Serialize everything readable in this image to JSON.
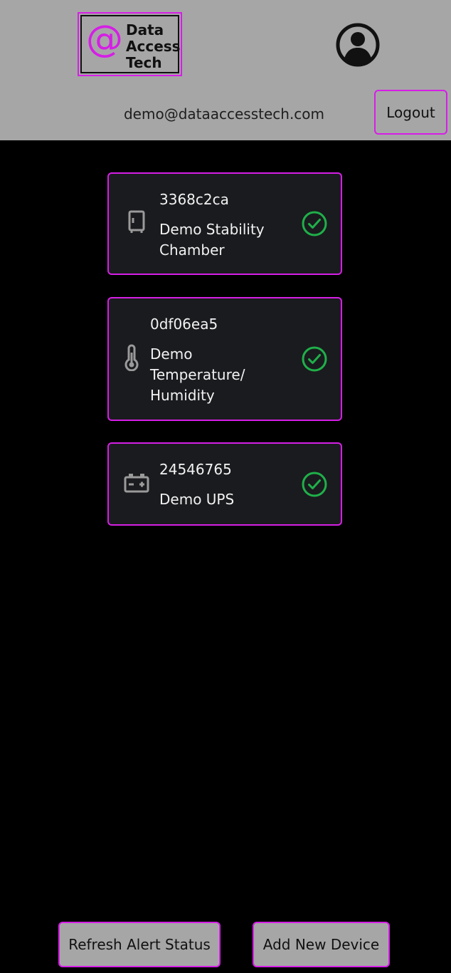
{
  "header": {
    "logo": {
      "symbol": "@",
      "lines": [
        "Data",
        "Access",
        "Tech"
      ]
    },
    "user_email": "demo@dataaccesstech.com",
    "logout_label": "Logout",
    "avatar_icon": "user-circle-icon"
  },
  "devices": [
    {
      "id": "3368c2ca",
      "name": "Demo Stability Chamber",
      "icon": "cabinet-icon",
      "status": "ok"
    },
    {
      "id": "0df06ea5",
      "name": "Demo Temperature/ Humidity",
      "icon": "thermometer-icon",
      "status": "ok"
    },
    {
      "id": "24546765",
      "name": "Demo UPS",
      "icon": "battery-icon",
      "status": "ok"
    }
  ],
  "footer": {
    "refresh_label": "Refresh Alert Status",
    "add_label": "Add New Device"
  },
  "colors": {
    "accent": "#d61ee6",
    "status_ok": "#1fb04a",
    "header_bg": "#a6a6a6",
    "card_bg": "#1a1b1e",
    "page_bg": "#000000"
  }
}
